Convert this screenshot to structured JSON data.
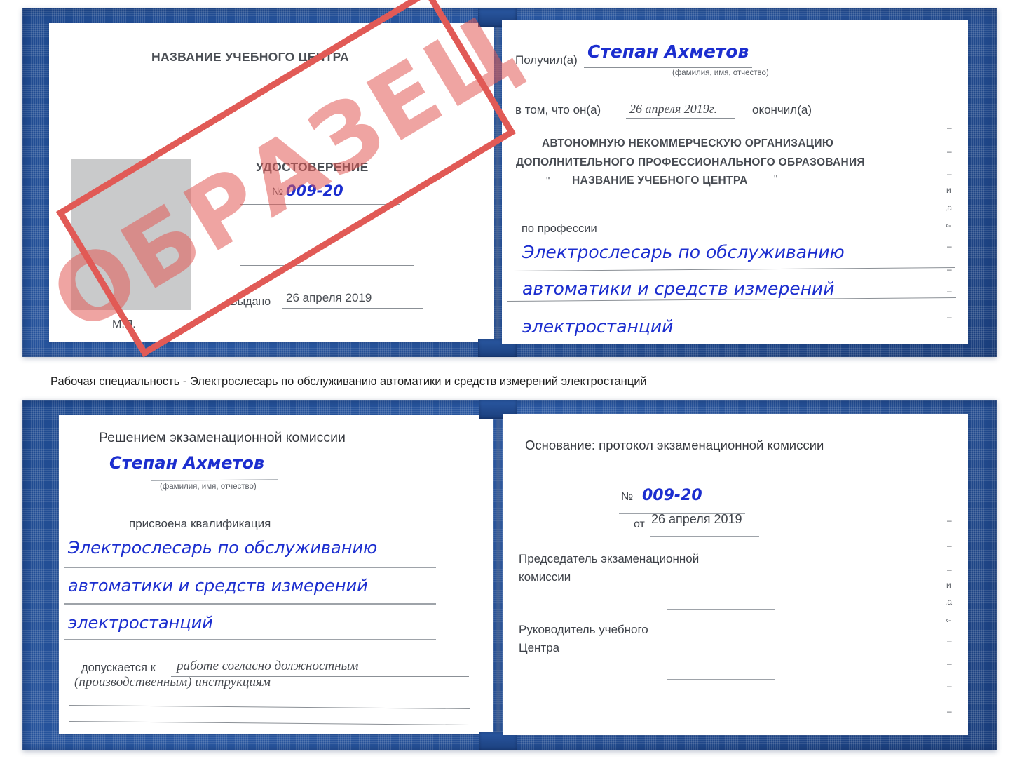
{
  "caption": {
    "text": "Рабочая специальность - Электрослесарь по обслуживанию автоматики и средств измерений электростанций"
  },
  "stamp": {
    "label": "ОБРАЗЕЦ",
    "border_color": "#e15a56",
    "text_color": "#e15a56"
  },
  "colors": {
    "cover_blue": "#2a58a2",
    "cover_blue_dark": "#1b3f7d",
    "handwriting_blue": "#1c2ecf",
    "stamp_red": "#e15a56",
    "photo_grey": "#c9cacb",
    "print_grey": "#54575c"
  },
  "certificate_top": {
    "left_page": {
      "header": "НАЗВАНИЕ УЧЕБНОГО ЦЕНТРА",
      "title": "УДОСТОВЕРЕНИЕ",
      "number_label": "№",
      "number_value": "009-20",
      "issued_label": "Выдано",
      "issued_value": "26 апреля 2019",
      "seal_label": "М.П.",
      "photo_placeholder": ""
    },
    "right_page": {
      "received_label": "Получил(а)",
      "received_value": "Степан Ахметов",
      "name_hint": "(фамилия, имя, отчество)",
      "in_that_label": "в том, что он(а)",
      "in_that_value": "26 апреля 2019г.",
      "graduated_label": "окончил(а)",
      "org_line1": "АВТОНОМНУЮ НЕКОММЕРЧЕСКУЮ ОРГАНИЗАЦИЮ",
      "org_line2": "ДОПОЛНИТЕЛЬНОГО ПРОФЕССИОНАЛЬНОГО ОБРАЗОВАНИЯ",
      "org_quote_open": "\"",
      "org_line3": "НАЗВАНИЕ УЧЕБНОГО ЦЕНТРА",
      "org_quote_close": "\"",
      "profession_label": "по профессии",
      "profession_line1": "Электрослесарь по обслуживанию",
      "profession_line2": "автоматики и средств измерений",
      "profession_line3": "электростанций",
      "edge_glyphs": [
        "–",
        "–",
        "–",
        "и",
        ",а",
        "‹-",
        "–",
        "–",
        "–",
        "–"
      ]
    }
  },
  "certificate_bottom": {
    "left_page": {
      "header": "Решением экзаменационной комиссии",
      "name_value": "Степан Ахметов",
      "name_hint": "(фамилия, имя, отчество)",
      "qualification_label": "присвоена квалификация",
      "qualification_line1": "Электрослесарь по обслуживанию",
      "qualification_line2": "автоматики и средств измерений",
      "qualification_line3": "электростанций",
      "admitted_label": "допускается к",
      "admitted_line1": "работе согласно должностным",
      "admitted_line2": "(производственным) инструкциям"
    },
    "right_page": {
      "basis_label": "Основание: протокол экзаменационной комиссии",
      "number_label": "№",
      "number_value": "009-20",
      "date_label": "от",
      "date_value": "26 апреля 2019",
      "chairman_line1": "Председатель экзаменационной",
      "chairman_line2": "комиссии",
      "head_line1": "Руководитель учебного",
      "head_line2": "Центра",
      "edge_glyphs": [
        "–",
        "–",
        "–",
        "и",
        ",а",
        "‹-",
        "–",
        "–",
        "–",
        "–"
      ]
    }
  }
}
